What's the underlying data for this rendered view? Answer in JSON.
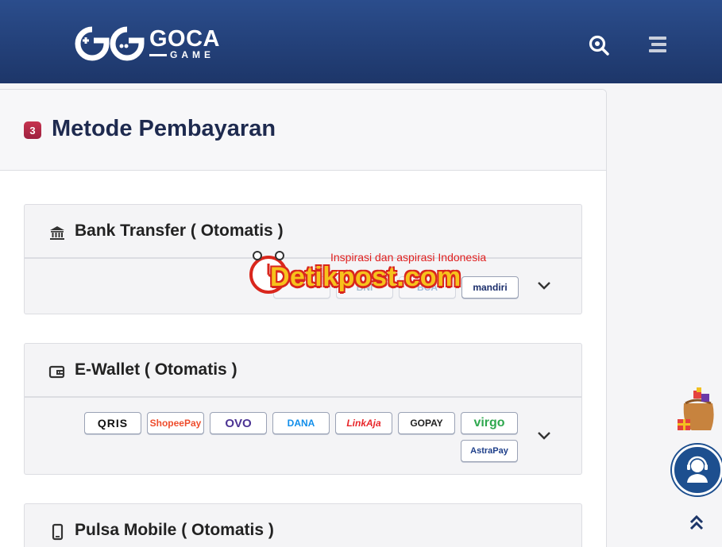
{
  "header": {
    "brand_name": "GOCA",
    "brand_sub": "GAME",
    "search_icon": "search-icon",
    "menu_icon": "menu-icon"
  },
  "payment": {
    "step_number": "3",
    "title": "Metode Pembayaran",
    "sections": [
      {
        "title": "Bank Transfer ( Otomatis )",
        "icon": "bank-icon",
        "logos": [
          "",
          "BNI",
          "BCA",
          "mandiri"
        ]
      },
      {
        "title": "E-Wallet ( Otomatis )",
        "icon": "wallet-icon",
        "logos": [
          "QRIS",
          "ShopeePay",
          "OVO",
          "DANA",
          "LinkAja",
          "GOPAY",
          "virgo",
          "AstraPay"
        ]
      },
      {
        "title": "Pulsa Mobile ( Otomatis )",
        "icon": "mobile-icon"
      }
    ]
  },
  "watermark": {
    "tagline": "Inspirasi dan aspirasi Indonesia",
    "brand": "Detikpost.com"
  },
  "floating": {
    "gift_icon": "gift-icon",
    "support_icon": "support-icon",
    "scroll_top_icon": "scroll-top-icon"
  },
  "colors": {
    "header_bg": "#1d3669",
    "title_color": "#1e2a4f",
    "badge": "#b02a48"
  }
}
